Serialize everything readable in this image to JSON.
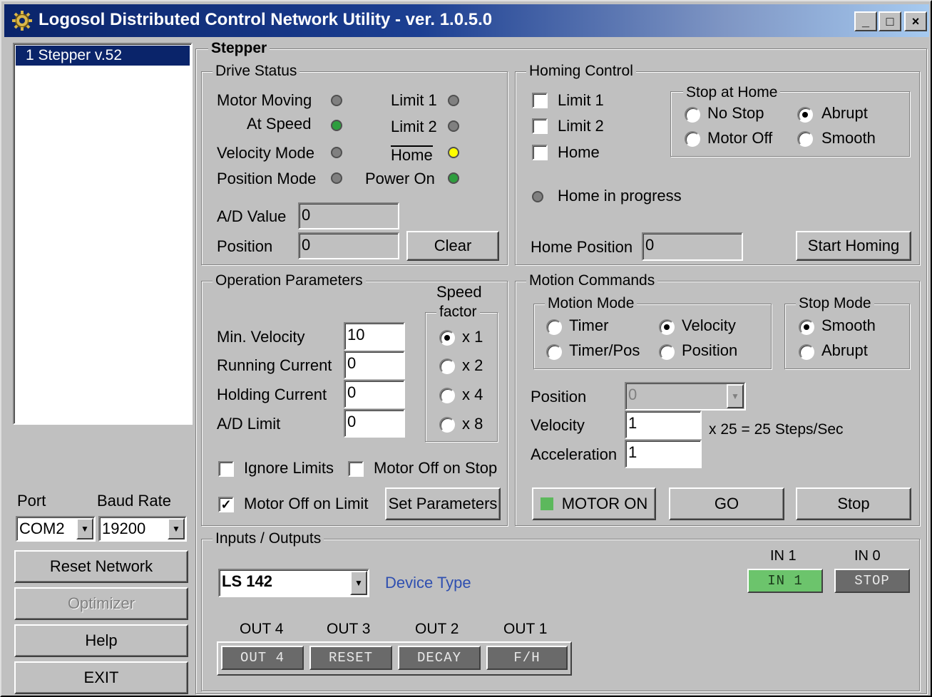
{
  "window": {
    "title": "Logosol Distributed Control Network Utility - ver. 1.0.5.0",
    "app_icon": "gear-icon",
    "controls": {
      "minimize": "_",
      "maximize": "□",
      "close": "×"
    }
  },
  "node_list": {
    "items": [
      "1 Stepper v.52"
    ],
    "selected": 0
  },
  "port_label": "Port",
  "baud_label": "Baud Rate",
  "port_value": "COM2",
  "baud_value": "19200",
  "buttons_left": {
    "reset": "Reset Network",
    "optimizer": "Optimizer",
    "help": "Help",
    "exit": "EXIT"
  },
  "panel_title": "Stepper",
  "drive_status": {
    "title": "Drive Status",
    "motor_moving": "Motor Moving",
    "at_speed": "At Speed",
    "velocity_mode": "Velocity Mode",
    "position_mode": "Position Mode",
    "limit1": "Limit 1",
    "limit2": "Limit 2",
    "home": "Home",
    "power_on": "Power On",
    "ad_value_label": "A/D Value",
    "ad_value": "0",
    "position_label": "Position",
    "position": "0",
    "clear": "Clear"
  },
  "homing": {
    "title": "Homing Control",
    "limit1": "Limit 1",
    "limit2": "Limit 2",
    "home": "Home",
    "stop_at_home": "Stop at Home",
    "no_stop": "No Stop",
    "abrupt": "Abrupt",
    "motor_off": "Motor Off",
    "smooth": "Smooth",
    "home_in_progress": "Home in progress",
    "home_position_label": "Home Position",
    "home_position": "0",
    "start": "Start Homing"
  },
  "op_params": {
    "title": "Operation Parameters",
    "speed_factor_1": "Speed",
    "speed_factor_2": "factor",
    "min_velocity_label": "Min. Velocity",
    "min_velocity": "10",
    "running_current_label": "Running Current",
    "running_current": "0",
    "holding_current_label": "Holding Current",
    "holding_current": "0",
    "ad_limit_label": "A/D Limit",
    "ad_limit": "0",
    "x1": "x 1",
    "x2": "x 2",
    "x4": "x 4",
    "x8": "x 8",
    "ignore_limits": "Ignore Limits",
    "motor_off_on_stop": "Motor Off on Stop",
    "motor_off_on_limit": "Motor Off on Limit",
    "set_parameters": "Set Parameters"
  },
  "motion": {
    "title": "Motion Commands",
    "motion_mode": "Motion  Mode",
    "timer": "Timer",
    "velocity_opt": "Velocity",
    "timer_pos": "Timer/Pos",
    "position_opt": "Position",
    "stop_mode": "Stop  Mode",
    "smooth": "Smooth",
    "abrupt": "Abrupt",
    "position_label": "Position",
    "position_value": "0",
    "velocity_label": "Velocity",
    "velocity_value": "1",
    "steps_text": "x 25 = 25 Steps/Sec",
    "accel_label": "Acceleration",
    "accel_value": "1",
    "motor_on": "MOTOR ON",
    "go": "GO",
    "stop": "Stop"
  },
  "io": {
    "title": "Inputs / Outputs",
    "device": "LS 142",
    "device_type": "Device Type",
    "in1_label": "IN 1",
    "in0_label": "IN 0",
    "in1_btn": "IN 1",
    "in0_btn": "STOP",
    "outputs": [
      {
        "label": "OUT 4",
        "btn": "OUT 4"
      },
      {
        "label": "OUT 3",
        "btn": "RESET"
      },
      {
        "label": "OUT 2",
        "btn": "DECAY"
      },
      {
        "label": "OUT 1",
        "btn": "F/H"
      }
    ]
  },
  "colors": {
    "title_bar": "#0a246a",
    "led_green": "#2e9e3e",
    "led_yellow": "#ffff00",
    "led_gray": "#808080",
    "in_active": "#6cc46c",
    "out_inactive": "#6a6a6a",
    "device_type_text": "#2f4fb0"
  }
}
